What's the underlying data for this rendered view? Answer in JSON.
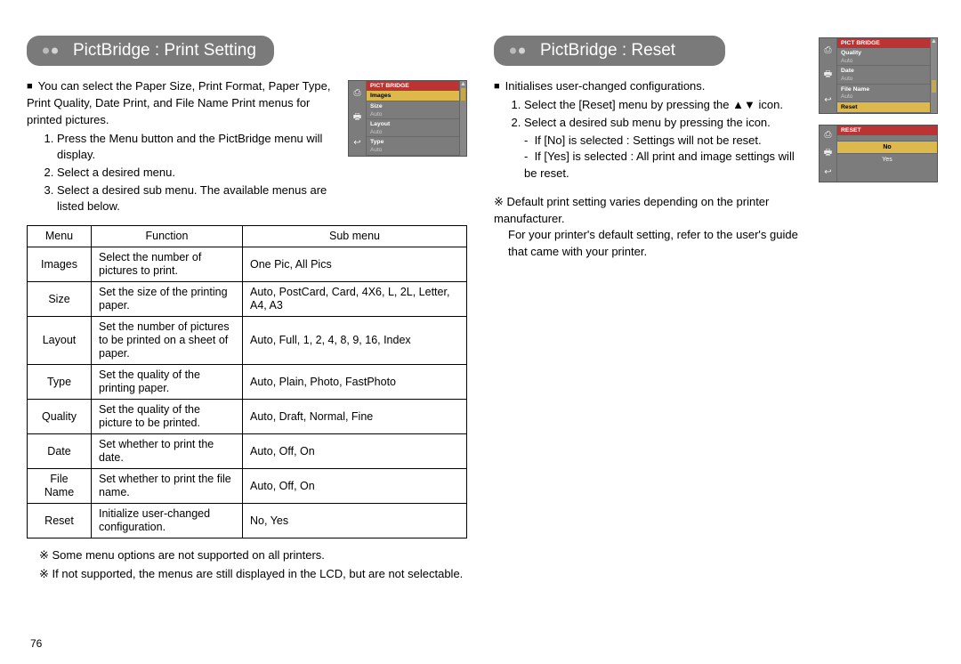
{
  "page_number": "76",
  "left": {
    "heading": "PictBridge : Print Setting",
    "intro": "You can select the Paper Size, Print Format, Paper Type, Print Quality, Date Print, and File Name Print menus for printed pictures.",
    "steps": [
      "Press the Menu button and the PictBridge menu will display.",
      "Select a desired menu.",
      "Select a desired sub menu. The available menus are listed below."
    ],
    "lcd": {
      "title": "PICT BRIDGE",
      "items": [
        {
          "label": "Images",
          "value": "",
          "selected": true
        },
        {
          "label": "Size",
          "value": "Auto"
        },
        {
          "label": "Layout",
          "value": "Auto"
        },
        {
          "label": "Type",
          "value": "Auto"
        }
      ]
    },
    "table": {
      "headers": [
        "Menu",
        "Function",
        "Sub menu"
      ],
      "rows": [
        {
          "menu": "Images",
          "func": "Select the number of pictures to print.",
          "sub": "One Pic, All Pics"
        },
        {
          "menu": "Size",
          "func": "Set the size of the printing paper.",
          "sub": "Auto, PostCard, Card, 4X6, L, 2L, Letter, A4, A3"
        },
        {
          "menu": "Layout",
          "func": "Set the number of pictures to be printed on a sheet of paper.",
          "sub": "Auto, Full, 1, 2, 4, 8, 9, 16, Index"
        },
        {
          "menu": "Type",
          "func": "Set the quality of the printing paper.",
          "sub": "Auto, Plain, Photo, FastPhoto"
        },
        {
          "menu": "Quality",
          "func": "Set the quality of the picture to be printed.",
          "sub": "Auto, Draft, Normal, Fine"
        },
        {
          "menu": "Date",
          "func": "Set whether to print the date.",
          "sub": "Auto, Off, On"
        },
        {
          "menu": "File Name",
          "func": "Set whether to print the file name.",
          "sub": "Auto, Off, On"
        },
        {
          "menu": "Reset",
          "func": "Initialize user-changed configuration.",
          "sub": "No, Yes"
        }
      ]
    },
    "notes": [
      "Some menu options are not supported on all printers.",
      "If not supported, the menus are still displayed in the LCD, but are not selectable."
    ]
  },
  "right": {
    "heading": "PictBridge : Reset",
    "intro": "Initialises user-changed configurations.",
    "steps": [
      "Select the [Reset] menu by pressing the ▲▼ icon.",
      "Select a desired sub menu by pressing the icon."
    ],
    "subnotes": [
      "If [No] is selected : Settings will not be reset.",
      "If [Yes] is selected : All print and image settings will be reset."
    ],
    "lcd1": {
      "title": "PICT BRIDGE",
      "items": [
        {
          "label": "Quality",
          "value": "Auto"
        },
        {
          "label": "Date",
          "value": "Auto"
        },
        {
          "label": "File Name",
          "value": "Auto"
        },
        {
          "label": "Reset",
          "value": "",
          "selected": true
        }
      ]
    },
    "lcd2": {
      "title": "RESET",
      "options": [
        "No",
        "Yes"
      ],
      "selected": "No"
    },
    "footnote1": "Default print setting varies depending on the printer manufacturer.",
    "footnote2": "For your printer's default setting, refer to the user's guide that came with your printer."
  }
}
